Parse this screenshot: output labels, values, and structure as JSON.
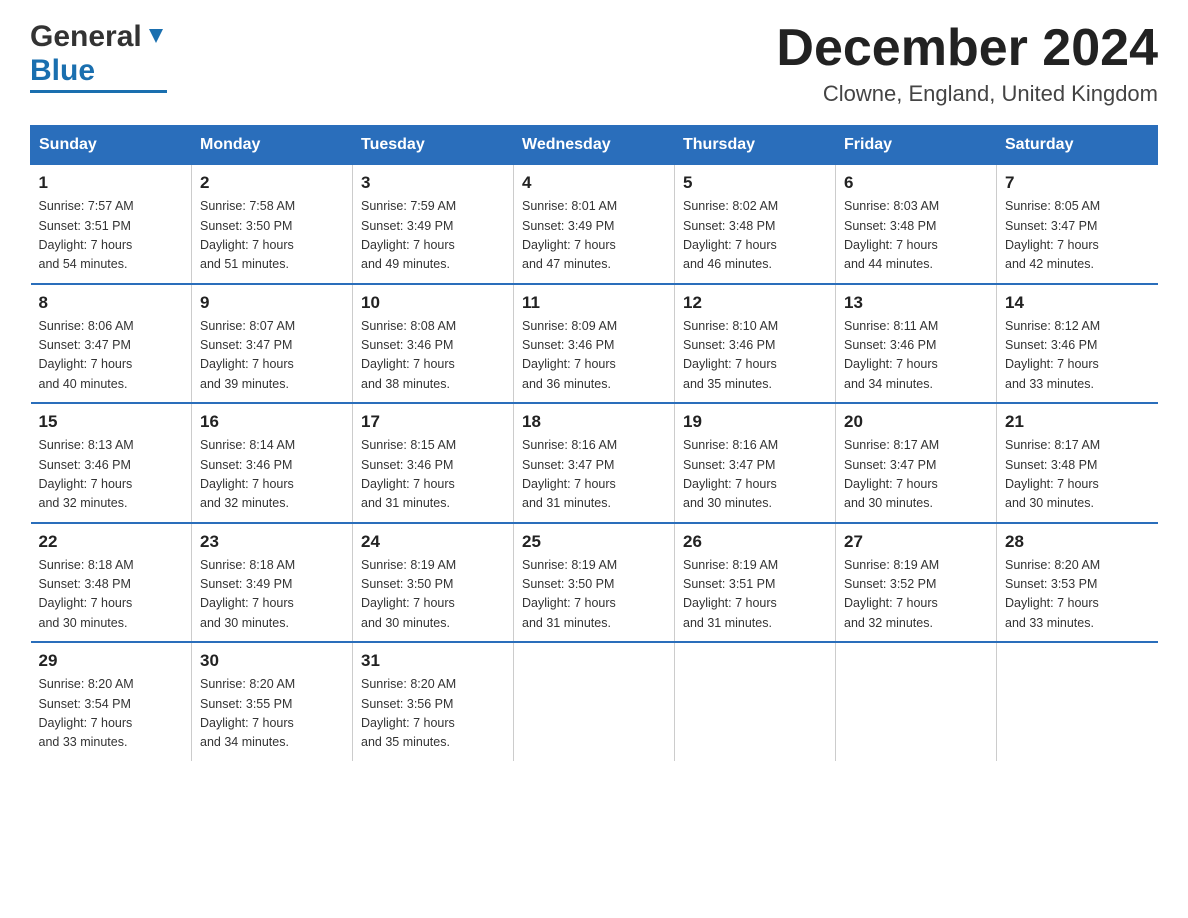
{
  "header": {
    "month_title": "December 2024",
    "location": "Clowne, England, United Kingdom",
    "logo_general": "General",
    "logo_blue": "Blue"
  },
  "weekdays": [
    "Sunday",
    "Monday",
    "Tuesday",
    "Wednesday",
    "Thursday",
    "Friday",
    "Saturday"
  ],
  "weeks": [
    [
      {
        "day": "1",
        "sunrise": "7:57 AM",
        "sunset": "3:51 PM",
        "daylight": "7 hours and 54 minutes."
      },
      {
        "day": "2",
        "sunrise": "7:58 AM",
        "sunset": "3:50 PM",
        "daylight": "7 hours and 51 minutes."
      },
      {
        "day": "3",
        "sunrise": "7:59 AM",
        "sunset": "3:49 PM",
        "daylight": "7 hours and 49 minutes."
      },
      {
        "day": "4",
        "sunrise": "8:01 AM",
        "sunset": "3:49 PM",
        "daylight": "7 hours and 47 minutes."
      },
      {
        "day": "5",
        "sunrise": "8:02 AM",
        "sunset": "3:48 PM",
        "daylight": "7 hours and 46 minutes."
      },
      {
        "day": "6",
        "sunrise": "8:03 AM",
        "sunset": "3:48 PM",
        "daylight": "7 hours and 44 minutes."
      },
      {
        "day": "7",
        "sunrise": "8:05 AM",
        "sunset": "3:47 PM",
        "daylight": "7 hours and 42 minutes."
      }
    ],
    [
      {
        "day": "8",
        "sunrise": "8:06 AM",
        "sunset": "3:47 PM",
        "daylight": "7 hours and 40 minutes."
      },
      {
        "day": "9",
        "sunrise": "8:07 AM",
        "sunset": "3:47 PM",
        "daylight": "7 hours and 39 minutes."
      },
      {
        "day": "10",
        "sunrise": "8:08 AM",
        "sunset": "3:46 PM",
        "daylight": "7 hours and 38 minutes."
      },
      {
        "day": "11",
        "sunrise": "8:09 AM",
        "sunset": "3:46 PM",
        "daylight": "7 hours and 36 minutes."
      },
      {
        "day": "12",
        "sunrise": "8:10 AM",
        "sunset": "3:46 PM",
        "daylight": "7 hours and 35 minutes."
      },
      {
        "day": "13",
        "sunrise": "8:11 AM",
        "sunset": "3:46 PM",
        "daylight": "7 hours and 34 minutes."
      },
      {
        "day": "14",
        "sunrise": "8:12 AM",
        "sunset": "3:46 PM",
        "daylight": "7 hours and 33 minutes."
      }
    ],
    [
      {
        "day": "15",
        "sunrise": "8:13 AM",
        "sunset": "3:46 PM",
        "daylight": "7 hours and 32 minutes."
      },
      {
        "day": "16",
        "sunrise": "8:14 AM",
        "sunset": "3:46 PM",
        "daylight": "7 hours and 32 minutes."
      },
      {
        "day": "17",
        "sunrise": "8:15 AM",
        "sunset": "3:46 PM",
        "daylight": "7 hours and 31 minutes."
      },
      {
        "day": "18",
        "sunrise": "8:16 AM",
        "sunset": "3:47 PM",
        "daylight": "7 hours and 31 minutes."
      },
      {
        "day": "19",
        "sunrise": "8:16 AM",
        "sunset": "3:47 PM",
        "daylight": "7 hours and 30 minutes."
      },
      {
        "day": "20",
        "sunrise": "8:17 AM",
        "sunset": "3:47 PM",
        "daylight": "7 hours and 30 minutes."
      },
      {
        "day": "21",
        "sunrise": "8:17 AM",
        "sunset": "3:48 PM",
        "daylight": "7 hours and 30 minutes."
      }
    ],
    [
      {
        "day": "22",
        "sunrise": "8:18 AM",
        "sunset": "3:48 PM",
        "daylight": "7 hours and 30 minutes."
      },
      {
        "day": "23",
        "sunrise": "8:18 AM",
        "sunset": "3:49 PM",
        "daylight": "7 hours and 30 minutes."
      },
      {
        "day": "24",
        "sunrise": "8:19 AM",
        "sunset": "3:50 PM",
        "daylight": "7 hours and 30 minutes."
      },
      {
        "day": "25",
        "sunrise": "8:19 AM",
        "sunset": "3:50 PM",
        "daylight": "7 hours and 31 minutes."
      },
      {
        "day": "26",
        "sunrise": "8:19 AM",
        "sunset": "3:51 PM",
        "daylight": "7 hours and 31 minutes."
      },
      {
        "day": "27",
        "sunrise": "8:19 AM",
        "sunset": "3:52 PM",
        "daylight": "7 hours and 32 minutes."
      },
      {
        "day": "28",
        "sunrise": "8:20 AM",
        "sunset": "3:53 PM",
        "daylight": "7 hours and 33 minutes."
      }
    ],
    [
      {
        "day": "29",
        "sunrise": "8:20 AM",
        "sunset": "3:54 PM",
        "daylight": "7 hours and 33 minutes."
      },
      {
        "day": "30",
        "sunrise": "8:20 AM",
        "sunset": "3:55 PM",
        "daylight": "7 hours and 34 minutes."
      },
      {
        "day": "31",
        "sunrise": "8:20 AM",
        "sunset": "3:56 PM",
        "daylight": "7 hours and 35 minutes."
      },
      null,
      null,
      null,
      null
    ]
  ],
  "labels": {
    "sunrise": "Sunrise:",
    "sunset": "Sunset:",
    "daylight": "Daylight:"
  }
}
